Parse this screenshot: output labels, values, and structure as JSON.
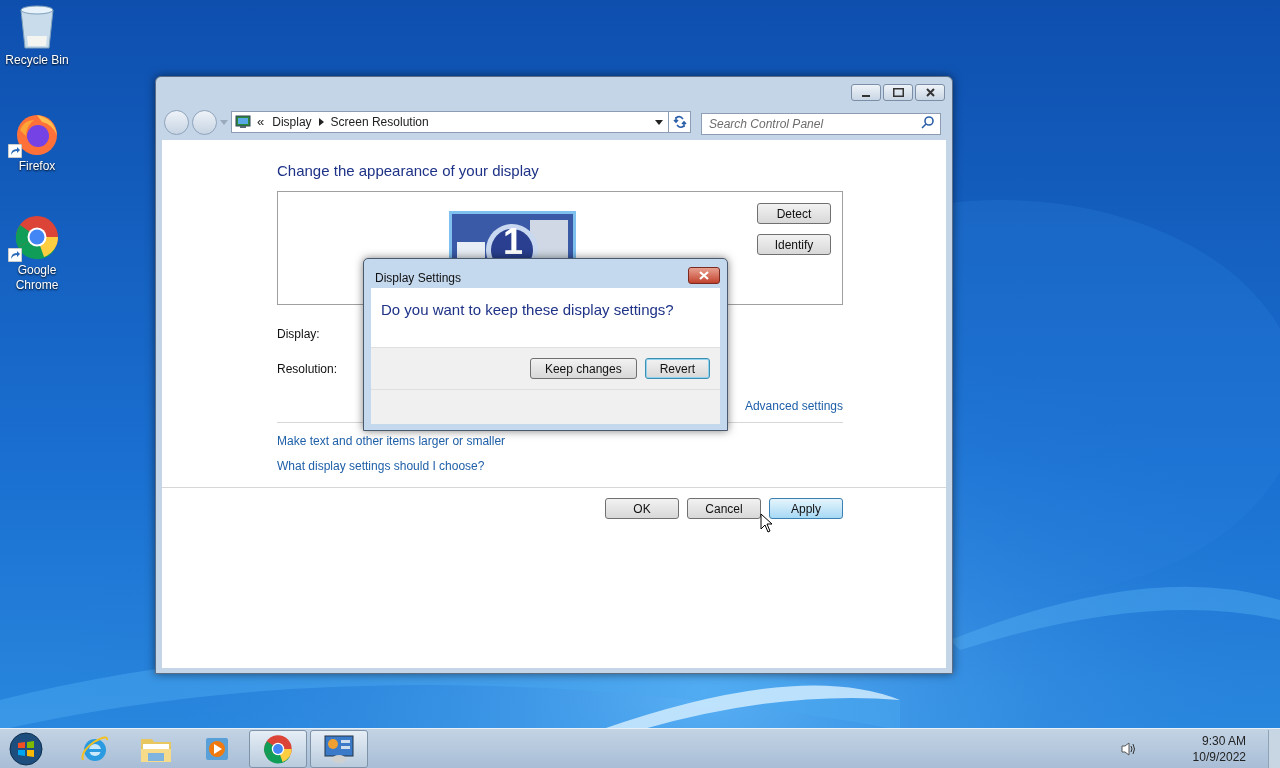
{
  "desktop_icons": [
    {
      "label": "Recycle Bin",
      "kind": "recycle",
      "shortcut": false
    },
    {
      "label": "Firefox",
      "kind": "firefox",
      "shortcut": true
    },
    {
      "label": "Google Chrome",
      "kind": "chrome",
      "shortcut": true
    }
  ],
  "window": {
    "address": {
      "prefix": "«",
      "crumbs": [
        "Display",
        "Screen Resolution"
      ]
    },
    "search": {
      "placeholder": "Search Control Panel"
    },
    "heading": "Change the appearance of your display",
    "monitor": {
      "number": "1"
    },
    "side_buttons": [
      "Detect",
      "Identify"
    ],
    "field_labels": [
      "Display:",
      "Resolution:"
    ],
    "advanced_link": "Advanced settings",
    "links": [
      "Make text and other items larger or smaller",
      "What display settings should I choose?"
    ],
    "footer_buttons": [
      {
        "label": "OK",
        "default": false
      },
      {
        "label": "Cancel",
        "default": false
      },
      {
        "label": "Apply",
        "default": true
      }
    ]
  },
  "dialog": {
    "title": "Display Settings",
    "question": "Do you want to keep these display settings?",
    "buttons": [
      {
        "label": "Keep changes",
        "default": false
      },
      {
        "label": "Revert",
        "default": true
      }
    ]
  },
  "taskbar": {
    "items": [
      {
        "kind": "ie",
        "open": false
      },
      {
        "kind": "folder",
        "open": false
      },
      {
        "kind": "media",
        "open": false
      },
      {
        "kind": "chrome",
        "open": true
      },
      {
        "kind": "control-panel",
        "open": true
      }
    ],
    "clock": {
      "time": "9:30 AM",
      "date": "10/9/2022"
    }
  }
}
